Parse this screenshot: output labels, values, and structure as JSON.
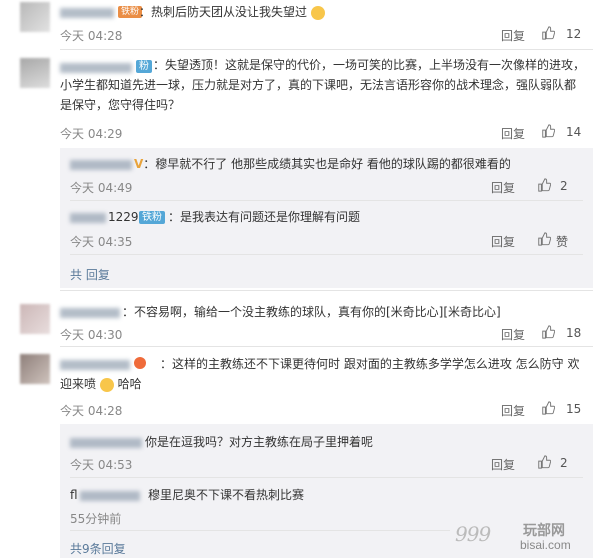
{
  "comments": [
    {
      "name": "",
      "badge": "铁粉",
      "text": "：热刺后防天团从没让我失望过",
      "time": "今天 04:28",
      "reply_label": "回复",
      "likes": "12"
    },
    {
      "name": "",
      "badge": "粉",
      "text": "：失望透顶！这就是保守的代价，一场可笑的比赛，上半场没有一次像样的进攻，小学生都知道先进一球，压力就是对方了，真的下课吧，无法言语形容你的战术理念，强队弱队都是保守，您守得住吗？",
      "time": "今天 04:29",
      "reply_label": "回复",
      "likes": "14",
      "replies": [
        {
          "name": "",
          "text": "：穆早就不行了 他那些成绩其实也是命好 看他的球队踢的都很难看的",
          "time": "今天 04:49",
          "reply_label": "回复",
          "likes": "2"
        },
        {
          "name": "1229",
          "badge": "铁粉",
          "text": "：是我表达有问题还是你理解有问题",
          "time": "今天 04:35",
          "reply_label": "回复",
          "likes": "赞"
        }
      ],
      "more": "共  回复"
    },
    {
      "name": "",
      "text": "：不容易啊，输给一个没主教练的球队，真有你的[米奇比心][米奇比心]",
      "time": "今天 04:30",
      "reply_label": "回复",
      "likes": "18"
    },
    {
      "name": "",
      "text": "：这样的主教练还不下课更待何时 跟对面的主教练多学学怎么进攻 怎么防守 欢迎来喷",
      "text_tail": "哈哈",
      "time": "今天 04:28",
      "reply_label": "回复",
      "likes": "15",
      "replies": [
        {
          "name": "",
          "text": "你是在逗我吗？对方主教练在局子里押着呢",
          "time": "今天 04:53",
          "reply_label": "回复",
          "likes": "2"
        },
        {
          "name": "fl",
          "text": "穆里尼奥不下课不看热刺比赛",
          "time": "55分钟前",
          "reply_label": "回复",
          "likes": ""
        }
      ],
      "more": "共9条回复"
    }
  ],
  "watermark": {
    "mark": "999",
    "brand": "玩部网",
    "domain": "bisai.com"
  }
}
